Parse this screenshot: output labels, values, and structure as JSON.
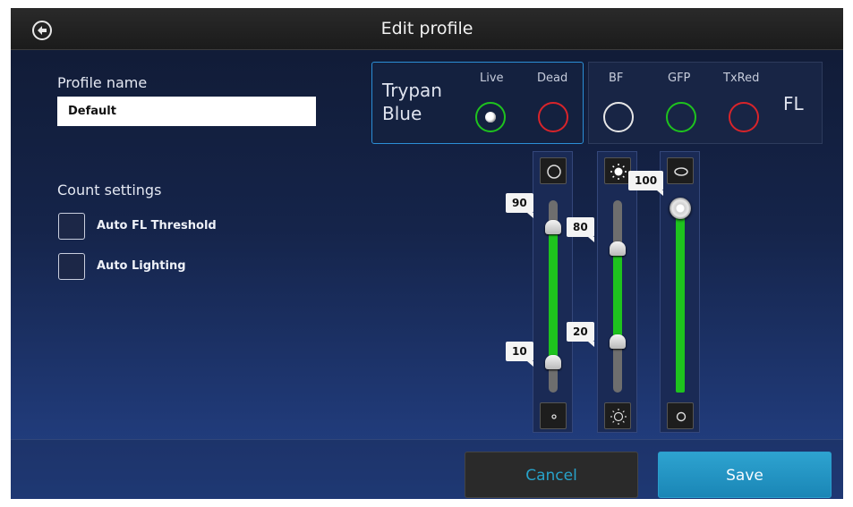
{
  "header": {
    "title": "Edit profile"
  },
  "profile": {
    "label": "Profile name",
    "name_value": "Default"
  },
  "count_settings": {
    "label": "Count settings",
    "options": [
      {
        "label": "Auto FL Threshold",
        "checked": false
      },
      {
        "label": "Auto Lighting",
        "checked": false
      }
    ]
  },
  "channels": {
    "trypan_label_line1": "Trypan",
    "trypan_label_line2": "Blue",
    "live": {
      "label": "Live",
      "color": "#1ec31e",
      "selected": true
    },
    "dead": {
      "label": "Dead",
      "color": "#d8242a",
      "selected": false
    },
    "fl_label": "FL",
    "bf": {
      "label": "BF",
      "color": "#e6e6e6"
    },
    "gfp": {
      "label": "GFP",
      "color": "#1ec31e"
    },
    "txred": {
      "label": "TxRed",
      "color": "#d8242a"
    }
  },
  "sliders": {
    "threshold": {
      "upper": "90",
      "lower": "10",
      "top_icon": "large-circle-icon",
      "bottom_icon": "small-circle-icon"
    },
    "lighting": {
      "upper": "80",
      "lower": "20",
      "top_icon": "bright-sun-icon",
      "bottom_icon": "dim-sun-icon"
    },
    "focus": {
      "value": "100",
      "top_icon": "ellipse-icon",
      "bottom_icon": "circle-icon"
    }
  },
  "footer": {
    "cancel_label": "Cancel",
    "save_label": "Save"
  },
  "colors": {
    "accent": "#2ea3d0",
    "slider_fill": "#1ec31e"
  }
}
